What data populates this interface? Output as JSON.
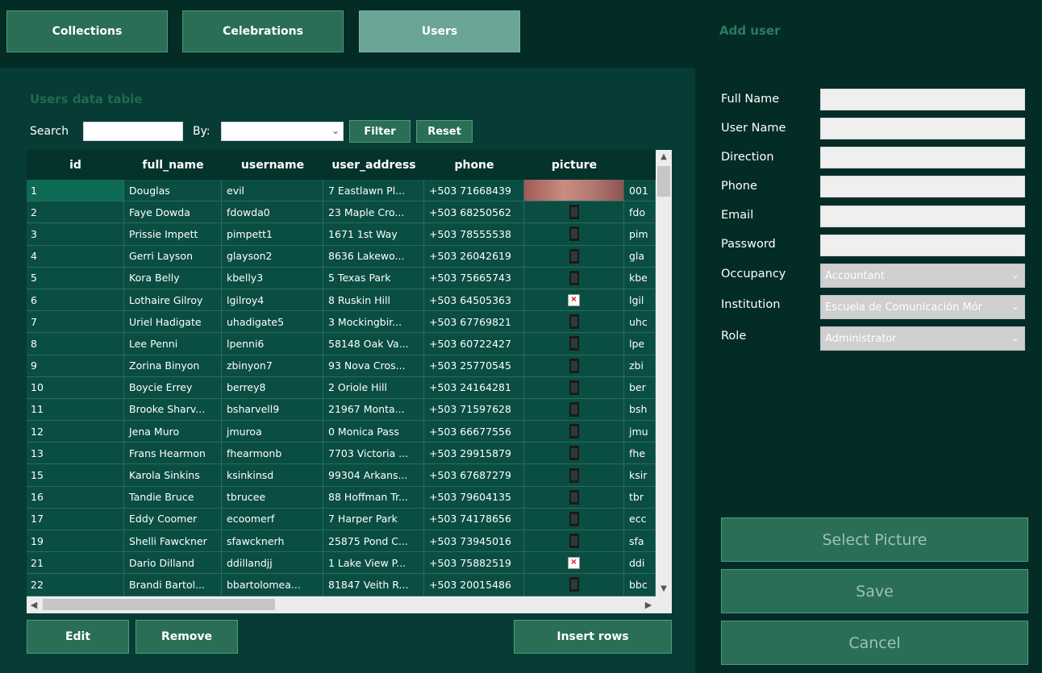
{
  "nav": {
    "collections": "Collections",
    "celebrations": "Celebrations",
    "users": "Users"
  },
  "panel_title": "Users data table",
  "search": {
    "label": "Search",
    "value": "",
    "by_label": "By:",
    "by_value": "",
    "filter": "Filter",
    "reset": "Reset"
  },
  "table": {
    "columns": [
      "id",
      "full_name",
      "username",
      "user_address",
      "phone",
      "picture"
    ],
    "rows": [
      {
        "id": "1",
        "full_name": "Douglas",
        "username": "evil",
        "address": "7 Eastlawn Pl...",
        "phone": "+503 71668439",
        "picture": "photo",
        "extra": "001"
      },
      {
        "id": "2",
        "full_name": "Faye Dowda",
        "username": "fdowda0",
        "address": "23 Maple Cro...",
        "phone": "+503 68250562",
        "picture": "icon",
        "extra": "fdo"
      },
      {
        "id": "3",
        "full_name": "Prissie Impett",
        "username": "pimpett1",
        "address": "1671 1st Way",
        "phone": "+503 78555538",
        "picture": "icon",
        "extra": "pim"
      },
      {
        "id": "4",
        "full_name": "Gerri Layson",
        "username": "glayson2",
        "address": "8636 Lakewo...",
        "phone": "+503 26042619",
        "picture": "icon",
        "extra": "gla"
      },
      {
        "id": "5",
        "full_name": "Kora Belly",
        "username": "kbelly3",
        "address": "5 Texas Park",
        "phone": "+503 75665743",
        "picture": "icon",
        "extra": "kbe"
      },
      {
        "id": "6",
        "full_name": "Lothaire Gilroy",
        "username": "lgilroy4",
        "address": "8 Ruskin Hill",
        "phone": "+503 64505363",
        "picture": "broken",
        "extra": "lgil"
      },
      {
        "id": "7",
        "full_name": "Uriel Hadigate",
        "username": "uhadigate5",
        "address": "3 Mockingbir...",
        "phone": "+503 67769821",
        "picture": "icon",
        "extra": "uhc"
      },
      {
        "id": "8",
        "full_name": "Lee Penni",
        "username": "lpenni6",
        "address": "58148 Oak Va...",
        "phone": "+503 60722427",
        "picture": "icon",
        "extra": "lpe"
      },
      {
        "id": "9",
        "full_name": "Zorina Binyon",
        "username": "zbinyon7",
        "address": "93 Nova Cros...",
        "phone": "+503 25770545",
        "picture": "icon",
        "extra": "zbi"
      },
      {
        "id": "10",
        "full_name": "Boycie Errey",
        "username": "berrey8",
        "address": "2 Oriole Hill",
        "phone": "+503 24164281",
        "picture": "icon",
        "extra": "ber"
      },
      {
        "id": "11",
        "full_name": "Brooke Sharv...",
        "username": "bsharvell9",
        "address": "21967 Monta...",
        "phone": "+503 71597628",
        "picture": "icon",
        "extra": "bsh"
      },
      {
        "id": "12",
        "full_name": "Jena Muro",
        "username": "jmuroa",
        "address": "0 Monica Pass",
        "phone": "+503 66677556",
        "picture": "icon",
        "extra": "jmu"
      },
      {
        "id": "13",
        "full_name": "Frans Hearmon",
        "username": "fhearmonb",
        "address": "7703 Victoria ...",
        "phone": "+503 29915879",
        "picture": "icon",
        "extra": "fhe"
      },
      {
        "id": "15",
        "full_name": "Karola Sinkins",
        "username": "ksinkinsd",
        "address": "99304 Arkans...",
        "phone": "+503 67687279",
        "picture": "icon",
        "extra": "ksir"
      },
      {
        "id": "16",
        "full_name": "Tandie Bruce",
        "username": "tbrucee",
        "address": "88 Hoffman Tr...",
        "phone": "+503 79604135",
        "picture": "icon",
        "extra": "tbr"
      },
      {
        "id": "17",
        "full_name": "Eddy Coomer",
        "username": "ecoomerf",
        "address": "7 Harper Park",
        "phone": "+503 74178656",
        "picture": "icon",
        "extra": "ecc"
      },
      {
        "id": "19",
        "full_name": "Shelli Fawckner",
        "username": "sfawcknerh",
        "address": "25875 Pond C...",
        "phone": "+503 73945016",
        "picture": "icon",
        "extra": "sfa"
      },
      {
        "id": "21",
        "full_name": "Dario Dilland",
        "username": "ddillandjj",
        "address": "1 Lake View P...",
        "phone": "+503 75882519",
        "picture": "broken",
        "extra": "ddi"
      },
      {
        "id": "22",
        "full_name": "Brandi Bartol...",
        "username": "bbartolomea...",
        "address": "81847 Veith R...",
        "phone": "+503 20015486",
        "picture": "icon",
        "extra": "bbc"
      }
    ]
  },
  "actions": {
    "edit": "Edit",
    "remove": "Remove",
    "insert": "Insert rows"
  },
  "form": {
    "title": "Add user",
    "full_name_label": "Full Name",
    "user_name_label": "User Name",
    "direction_label": "Direction",
    "phone_label": "Phone",
    "email_label": "Email",
    "password_label": "Password",
    "occupancy_label": "Occupancy",
    "occupancy_value": "Accountant",
    "institution_label": "Institution",
    "institution_value": "Escuela de Comunicación Mór",
    "role_label": "Role",
    "role_value": "Administrator",
    "select_picture": "Select Picture",
    "save": "Save",
    "cancel": "Cancel"
  }
}
